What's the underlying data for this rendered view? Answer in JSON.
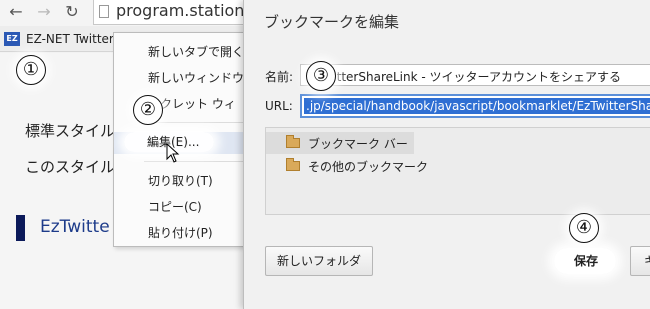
{
  "browser": {
    "url": "program.station",
    "icons": {
      "back": "back-arrow-icon",
      "forward": "forward-arrow-icon",
      "reload": "reload-icon",
      "page": "page-icon"
    },
    "bookmark_bar": {
      "favicon_text": "EZ",
      "item_label": "EZ-NET TwitterSh"
    }
  },
  "page": {
    "line1": "標準スタイル",
    "line2": "このスタイル",
    "link_text": "EzTwitte"
  },
  "context_menu": {
    "items": [
      "新しいタブで開く",
      "新しいウィンドウ",
      "ークレット ウィ",
      "編集(E)...",
      "切り取り(T)",
      "コピー(C)",
      "貼り付け(P)"
    ],
    "highlighted": "編集(E)..."
  },
  "dialog": {
    "title": "ブックマークを編集",
    "name_label": "名前:",
    "name_value": "T TwitterShareLink - ツイッターアカウントをシェアする",
    "url_label": "URL:",
    "url_value": ".jp/special/handbook/javascript/bookmarklet/EzTwitterShareLink",
    "folders": [
      {
        "label": "ブックマーク バー",
        "selected": true
      },
      {
        "label": "その他のブックマーク",
        "selected": false
      }
    ],
    "new_folder_button": "新しいフォルダ",
    "save_button": "保存",
    "cancel_button": "キ"
  },
  "markers": [
    "①",
    "②",
    "③",
    "④"
  ],
  "colors": {
    "url_selection": "#2f6fd3",
    "ez_bar": "#0c1a5a",
    "favicon": "#2b59b5"
  }
}
